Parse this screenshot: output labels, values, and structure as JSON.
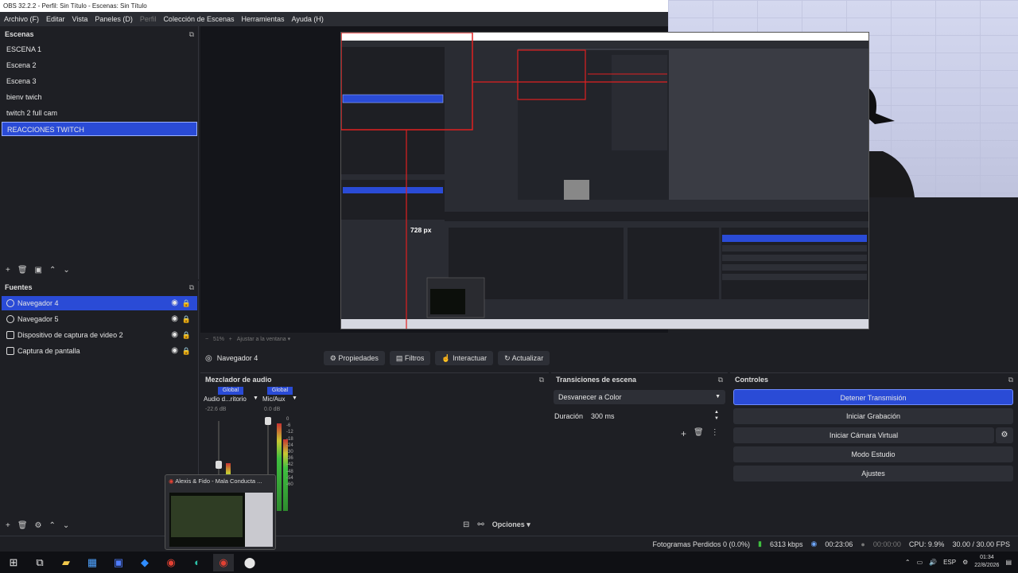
{
  "window": {
    "title": "OBS 32.2.2 - Perfil: Sin Título - Escenas: Sin Título"
  },
  "menu": [
    {
      "label": "Archivo (F)",
      "enabled": true
    },
    {
      "label": "Editar",
      "enabled": true
    },
    {
      "label": "Vista",
      "enabled": true
    },
    {
      "label": "Paneles (D)",
      "enabled": true
    },
    {
      "label": "Perfil",
      "enabled": false
    },
    {
      "label": "Colección de Escenas",
      "enabled": true
    },
    {
      "label": "Herramientas",
      "enabled": true
    },
    {
      "label": "Ayuda (H)",
      "enabled": true
    }
  ],
  "scenes": {
    "title": "Escenas",
    "items": [
      "ESCENA 1",
      "Escena 2",
      "Escena 3",
      "bienv twich",
      "twitch 2 full cam",
      "REACCIONES TWITCH"
    ],
    "selected": "REACCIONES TWITCH"
  },
  "sources": {
    "title": "Fuentes",
    "items": [
      "Navegador 4",
      "Navegador 5",
      "Dispositivo de captura de video 2",
      "Captura de pantalla"
    ],
    "selected": "Navegador 4"
  },
  "preview": {
    "overlay_label": "728 px",
    "zoom": "51%",
    "fit_label": "Ajustar a la ventana"
  },
  "source_toolbar": {
    "selected_source": "Navegador 4",
    "buttons": [
      "Propiedades",
      "Filtros",
      "Interactuar",
      "Actualizar"
    ]
  },
  "mixer": {
    "title": "Mezclador de audio",
    "channels": [
      {
        "tag": "Global",
        "name": "Audio d...ritorio",
        "level": "-22.6 dB"
      },
      {
        "tag": "Global",
        "name": "Mic/Aux",
        "level": "0.0 dB"
      }
    ],
    "scale": [
      "0",
      "-6",
      "-12",
      "-18",
      "-24",
      "-30",
      "-36",
      "-42",
      "-48",
      "-54",
      "-60"
    ],
    "options_label": "Opciones"
  },
  "transitions": {
    "title": "Transiciones de escena",
    "selected": "Desvanecer a Color",
    "duration_label": "Duración",
    "duration_value": "300 ms"
  },
  "controls": {
    "title": "Controles",
    "buttons": [
      "Detener Transmisión",
      "Iniciar Grabación",
      "Iniciar Cámara Virtual",
      "Modo Estudio",
      "Ajustes"
    ]
  },
  "status": {
    "dropped": "Fotogramas Perdidos 0 (0.0%)",
    "bitrate": "6313 kbps",
    "stream_time": "00:23:06",
    "rec_time": "00:00:00",
    "cpu": "CPU: 9.9%",
    "fps": "30.00 / 30.00 FPS"
  },
  "thumbnail": {
    "title": "Alexis & Fido - Mala Conducta ..."
  },
  "taskbar": {
    "lang": "ESP",
    "time": "01:34",
    "date": "22/8/2026"
  },
  "colors": {
    "accent": "#2a4bd6",
    "bg": "#1e1f24",
    "panel": "#2d2f36",
    "guide": "#e02020"
  }
}
